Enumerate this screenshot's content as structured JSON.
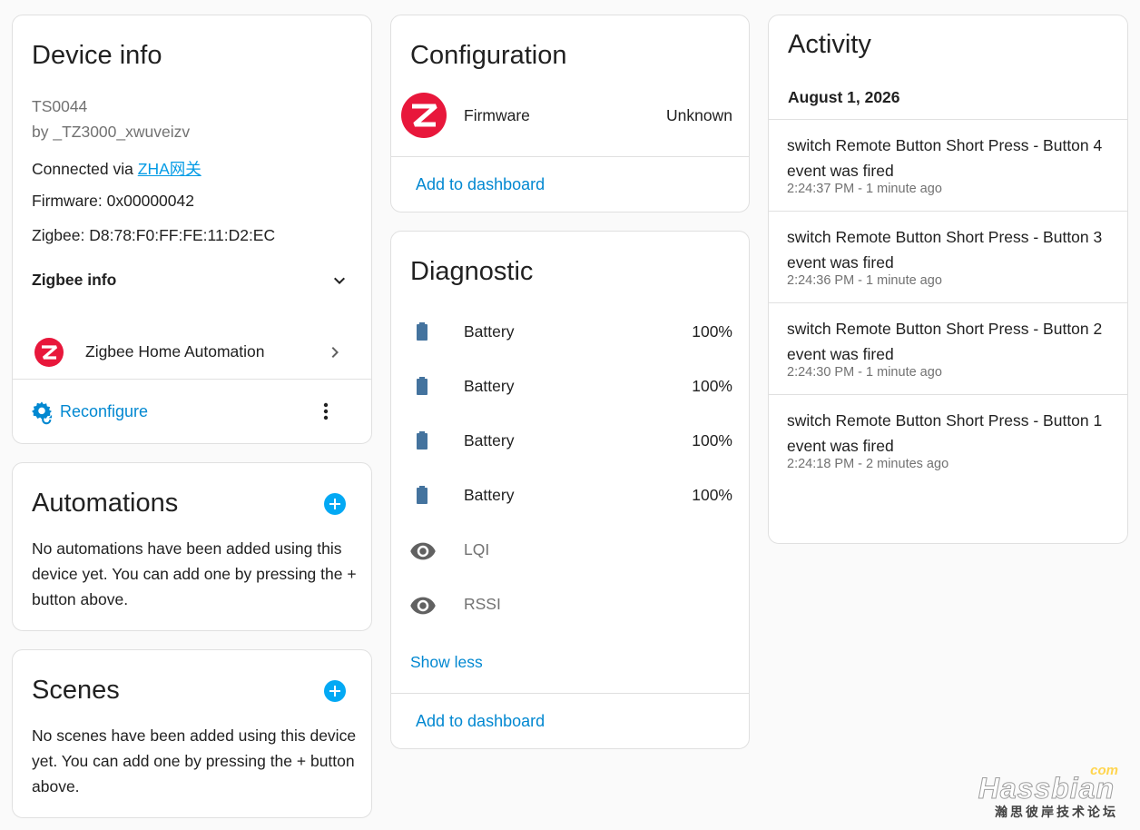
{
  "device_info": {
    "title": "Device info",
    "model": "TS0044",
    "manufacturer": "by _TZ3000_xwuveizv",
    "connected_via_prefix": "Connected via ",
    "connected_via_link": "ZHA网关",
    "firmware": "Firmware: 0x00000042",
    "zigbee": "Zigbee: D8:78:F0:FF:FE:11:D2:EC",
    "zigbee_info_label": "Zigbee info",
    "integration_label": "Zigbee Home Automation",
    "reconfigure_label": "Reconfigure"
  },
  "automations": {
    "title": "Automations",
    "empty_text": "No automations have been added using this device yet. You can add one by pressing the + button above."
  },
  "scenes": {
    "title": "Scenes",
    "empty_text": "No scenes have been added using this device yet. You can add one by pressing the + button above."
  },
  "configuration": {
    "title": "Configuration",
    "rows": [
      {
        "label": "Firmware",
        "value": "Unknown",
        "icon": "zigbee-logo-icon"
      }
    ],
    "add_to_dashboard": "Add to dashboard"
  },
  "diagnostic": {
    "title": "Diagnostic",
    "rows": [
      {
        "label": "Battery",
        "value": "100%",
        "icon": "battery-icon"
      },
      {
        "label": "Battery",
        "value": "100%",
        "icon": "battery-icon"
      },
      {
        "label": "Battery",
        "value": "100%",
        "icon": "battery-icon"
      },
      {
        "label": "Battery",
        "value": "100%",
        "icon": "battery-icon"
      },
      {
        "label": "LQI",
        "value": "",
        "icon": "eye-icon"
      },
      {
        "label": "RSSI",
        "value": "",
        "icon": "eye-icon"
      }
    ],
    "show_less": "Show less",
    "add_to_dashboard": "Add to dashboard"
  },
  "activity": {
    "title": "Activity",
    "date": "August 1, 2026",
    "events": [
      {
        "text": "switch Remote Button Short Press - Button 4 event was fired",
        "time": "2:24:37 PM - 1 minute ago"
      },
      {
        "text": "switch Remote Button Short Press - Button 3 event was fired",
        "time": "2:24:36 PM - 1 minute ago"
      },
      {
        "text": "switch Remote Button Short Press - Button 2 event was fired",
        "time": "2:24:30 PM - 1 minute ago"
      },
      {
        "text": "switch Remote Button Short Press - Button 1 event was fired",
        "time": "2:24:18 PM - 2 minutes ago"
      }
    ]
  },
  "watermark": {
    "brand": "Hassbian",
    "suffix": "com",
    "subtitle": "瀚思彼岸技术论坛"
  },
  "colors": {
    "accent": "#03a9f4",
    "link": "#0288d1",
    "zigbee_red": "#e8173b",
    "battery": "#44739e",
    "eye": "#616161"
  }
}
